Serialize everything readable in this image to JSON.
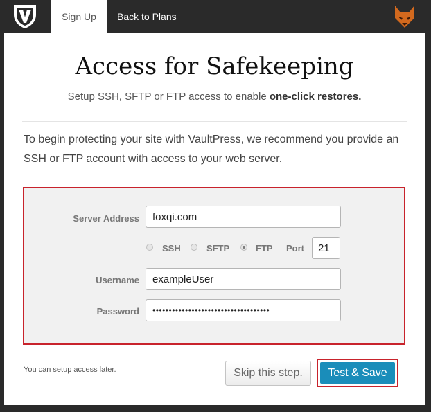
{
  "nav": {
    "logo_icon": "vaultpress-v-shield-icon",
    "tabs": [
      {
        "label": "Sign Up"
      },
      {
        "label": "Back to Plans"
      }
    ],
    "avatar_icon": "fox-mascot-icon"
  },
  "header": {
    "title": "Access for Safekeeping",
    "subtitle_prefix": "Setup SSH, SFTP or FTP access to enable ",
    "subtitle_bold": "one-click restores."
  },
  "intro_text": "To begin protecting your site with VaultPress, we recommend you provide an SSH or FTP account with access to your web server.",
  "form": {
    "server_address_label": "Server Address",
    "server_address_value": "foxqi.com",
    "protocols": [
      {
        "label": "SSH",
        "checked": false
      },
      {
        "label": "SFTP",
        "checked": false
      },
      {
        "label": "FTP",
        "checked": true
      }
    ],
    "port_label": "Port",
    "port_value": "21",
    "username_label": "Username",
    "username_value": "exampleUser",
    "password_label": "Password",
    "password_value": "••••••••••••••••••••••••••••••••••••"
  },
  "footer": {
    "note": "You can setup access later.",
    "skip_label": "Skip this step.",
    "save_label": "Test & Save"
  },
  "colors": {
    "highlight_border": "#c8232c",
    "primary_button": "#1a8dba",
    "topbar": "#2a2a2a"
  }
}
